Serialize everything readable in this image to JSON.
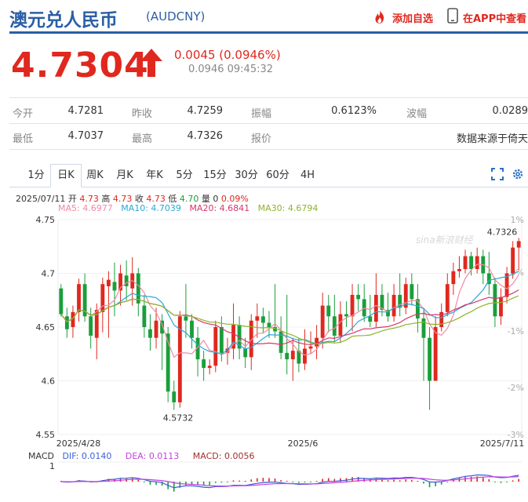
{
  "header": {
    "title": "澳元兑人民币",
    "code": "(AUDCNY)",
    "add_watchlist": "添加自选",
    "view_in_app": "在APP中查看"
  },
  "quote": {
    "price": "4.7304",
    "change": "0.0045 (0.0946%)",
    "time": "0.0946 09:45:32"
  },
  "stats": {
    "open_label": "今开",
    "open": "4.7281",
    "prev_close_label": "昨收",
    "prev_close": "4.7259",
    "amplitude_label": "振幅",
    "amplitude": "0.6123%",
    "volatility_label": "波幅",
    "volatility": "0.0289",
    "low_label": "最低",
    "low": "4.7037",
    "high_label": "最高",
    "high": "4.7326",
    "quote_label": "报价",
    "source": "数据来源于倚天"
  },
  "tabs": [
    "1分",
    "日K",
    "周K",
    "月K",
    "年K",
    "5分",
    "15分",
    "30分",
    "60分",
    "4H"
  ],
  "active_tab": 1,
  "info": {
    "date": "2025/07/11",
    "open_lbl": "开",
    "open_val": "4.73",
    "high_lbl": "高",
    "high_val": "4.73",
    "close_lbl": "收",
    "close_val": "4.73",
    "low_lbl": "低",
    "low_val": "4.70",
    "vol_lbl": "量",
    "vol_val": "0",
    "pct": "0.09%"
  },
  "ma": {
    "ma5": "MA5: 4.6977",
    "ma10": "MA10: 4.7039",
    "ma20": "MA20: 4.6841",
    "ma30": "MA30: 4.6794"
  },
  "watermark": "sina新浪财经",
  "chart_data": {
    "type": "candlestick",
    "y_ticks": [
      "4.75",
      "4.7",
      "4.65",
      "4.6",
      "4.55"
    ],
    "ylim": [
      4.55,
      4.75
    ],
    "pct_ticks": [
      "1%",
      "0%",
      "-1%",
      "-2%",
      "-3%"
    ],
    "x_ticks": [
      "2025/4/28",
      "2025/6",
      "2025/7/11"
    ],
    "annotations": {
      "max": "4.7326",
      "min": "4.5732"
    },
    "candles": [
      [
        4.686,
        4.662,
        4.69,
        4.66
      ],
      [
        4.66,
        4.648,
        4.668,
        4.64
      ],
      [
        4.65,
        4.664,
        4.67,
        4.64
      ],
      [
        4.664,
        4.69,
        4.695,
        4.655
      ],
      [
        4.69,
        4.66,
        4.7,
        4.655
      ],
      [
        4.66,
        4.642,
        4.668,
        4.63
      ],
      [
        4.64,
        4.666,
        4.672,
        4.62
      ],
      [
        4.664,
        4.69,
        4.696,
        4.645
      ],
      [
        4.688,
        4.694,
        4.702,
        4.64
      ],
      [
        4.692,
        4.684,
        4.71,
        4.66
      ],
      [
        4.684,
        4.7,
        4.708,
        4.67
      ],
      [
        4.698,
        4.688,
        4.712,
        4.675
      ],
      [
        4.686,
        4.7,
        4.715,
        4.67
      ],
      [
        4.7,
        4.672,
        4.705,
        4.66
      ],
      [
        4.67,
        4.65,
        4.68,
        4.64
      ],
      [
        4.648,
        4.64,
        4.662,
        4.628
      ],
      [
        4.64,
        4.656,
        4.668,
        4.63
      ],
      [
        4.656,
        4.644,
        4.662,
        4.61
      ],
      [
        4.644,
        4.59,
        4.65,
        4.58
      ],
      [
        4.59,
        4.58,
        4.6,
        4.573
      ],
      [
        4.58,
        4.66,
        4.665,
        4.575
      ],
      [
        4.66,
        4.656,
        4.69,
        4.64
      ],
      [
        4.656,
        4.64,
        4.662,
        4.63
      ],
      [
        4.64,
        4.62,
        4.65,
        4.604
      ],
      [
        4.62,
        4.612,
        4.628,
        4.6
      ],
      [
        4.612,
        4.614,
        4.62,
        4.606
      ],
      [
        4.614,
        4.65,
        4.656,
        4.608
      ],
      [
        4.65,
        4.626,
        4.66,
        4.618
      ],
      [
        4.626,
        4.63,
        4.64,
        4.615
      ],
      [
        4.63,
        4.652,
        4.672,
        4.62
      ],
      [
        4.652,
        4.63,
        4.66,
        4.62
      ],
      [
        4.63,
        4.622,
        4.64,
        4.612
      ],
      [
        4.622,
        4.656,
        4.662,
        4.61
      ],
      [
        4.656,
        4.66,
        4.672,
        4.64
      ],
      [
        4.66,
        4.654,
        4.668,
        4.645
      ],
      [
        4.654,
        4.65,
        4.665,
        4.64
      ],
      [
        4.65,
        4.646,
        4.69,
        4.64
      ],
      [
        4.646,
        4.626,
        4.66,
        4.62
      ],
      [
        4.626,
        4.62,
        4.68,
        4.606
      ],
      [
        4.62,
        4.628,
        4.64,
        4.6
      ],
      [
        4.628,
        4.616,
        4.64,
        4.608
      ],
      [
        4.616,
        4.63,
        4.648,
        4.61
      ],
      [
        4.63,
        4.632,
        4.646,
        4.625
      ],
      [
        4.632,
        4.64,
        4.652,
        4.62
      ],
      [
        4.64,
        4.67,
        4.682,
        4.63
      ],
      [
        4.67,
        4.66,
        4.68,
        4.645
      ],
      [
        4.66,
        4.642,
        4.68,
        4.636
      ],
      [
        4.642,
        4.662,
        4.674,
        4.636
      ],
      [
        4.662,
        4.66,
        4.674,
        4.65
      ],
      [
        4.66,
        4.68,
        4.69,
        4.646
      ],
      [
        4.68,
        4.676,
        4.69,
        4.665
      ],
      [
        4.676,
        4.66,
        4.69,
        4.655
      ],
      [
        4.66,
        4.655,
        4.68,
        4.65
      ],
      [
        4.655,
        4.68,
        4.7,
        4.65
      ],
      [
        4.68,
        4.666,
        4.69,
        4.66
      ],
      [
        4.666,
        4.66,
        4.682,
        4.655
      ],
      [
        4.66,
        4.68,
        4.69,
        4.655
      ],
      [
        4.68,
        4.668,
        4.7,
        4.66
      ],
      [
        4.668,
        4.69,
        4.696,
        4.662
      ],
      [
        4.69,
        4.676,
        4.7,
        4.67
      ],
      [
        4.676,
        4.658,
        4.69,
        4.645
      ],
      [
        4.658,
        4.64,
        4.668,
        4.6
      ],
      [
        4.64,
        4.6,
        4.65,
        4.573
      ],
      [
        4.6,
        4.65,
        4.66,
        4.6
      ],
      [
        4.65,
        4.664,
        4.672,
        4.646
      ],
      [
        4.664,
        4.69,
        4.7,
        4.66
      ],
      [
        4.69,
        4.702,
        4.71,
        4.68
      ],
      [
        4.702,
        4.704,
        4.716,
        4.696
      ],
      [
        4.704,
        4.716,
        4.722,
        4.7
      ],
      [
        4.716,
        4.704,
        4.72,
        4.698
      ],
      [
        4.704,
        4.716,
        4.724,
        4.7
      ],
      [
        4.716,
        4.7,
        4.722,
        4.69
      ],
      [
        4.7,
        4.69,
        4.72,
        4.68
      ],
      [
        4.69,
        4.66,
        4.696,
        4.65
      ],
      [
        4.66,
        4.678,
        4.686,
        4.652
      ],
      [
        4.678,
        4.7,
        4.706,
        4.672
      ],
      [
        4.7,
        4.724,
        4.73,
        4.695
      ],
      [
        4.724,
        4.73,
        4.733,
        4.703
      ]
    ]
  },
  "macd": {
    "label": "MACD",
    "dif": "DIF: 0.0140",
    "dea": "DEA: 0.0113",
    "macd": "MACD: 0.0056",
    "y_tick": "1"
  }
}
